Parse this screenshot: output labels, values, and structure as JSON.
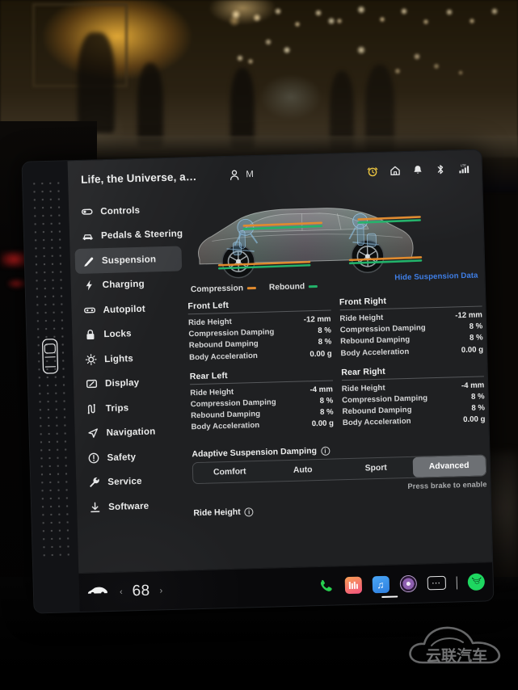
{
  "topbar": {
    "profile_title": "Life, the Universe, a…",
    "account_letter": "M",
    "icons": [
      {
        "name": "person-icon",
        "glyph": "person"
      },
      {
        "name": "alarm-clock-icon",
        "glyph": "alarm"
      },
      {
        "name": "home-icon",
        "glyph": "home"
      },
      {
        "name": "bell-icon",
        "glyph": "bell"
      },
      {
        "name": "bluetooth-icon",
        "glyph": "bluetooth"
      },
      {
        "name": "lte-signal-icon",
        "glyph": "lte"
      }
    ],
    "lte_label": "LTE"
  },
  "sidebar": {
    "items": [
      {
        "label": "Controls",
        "icon": "toggle-switch-icon",
        "active": false
      },
      {
        "label": "Pedals & Steering",
        "icon": "car-front-icon",
        "active": false
      },
      {
        "label": "Suspension",
        "icon": "shock-absorber-icon",
        "active": true
      },
      {
        "label": "Charging",
        "icon": "lightning-bolt-icon",
        "active": false
      },
      {
        "label": "Autopilot",
        "icon": "steering-assist-icon",
        "active": false
      },
      {
        "label": "Locks",
        "icon": "lock-icon",
        "active": false
      },
      {
        "label": "Lights",
        "icon": "sun-lights-icon",
        "active": false
      },
      {
        "label": "Display",
        "icon": "display-icon",
        "active": false
      },
      {
        "label": "Trips",
        "icon": "trips-icon",
        "active": false
      },
      {
        "label": "Navigation",
        "icon": "navigation-arrow-icon",
        "active": false
      },
      {
        "label": "Safety",
        "icon": "safety-info-icon",
        "active": false
      },
      {
        "label": "Service",
        "icon": "wrench-icon",
        "active": false
      },
      {
        "label": "Software",
        "icon": "download-icon",
        "active": false
      }
    ]
  },
  "suspension": {
    "legend": {
      "compression_label": "Compression",
      "compression_color": "#e08a2e",
      "rebound_label": "Rebound",
      "rebound_color": "#23b26a"
    },
    "hide_data_link": "Hide Suspension Data",
    "hide_data_link_color": "#3f7fe8",
    "corners": [
      {
        "title": "Front Left",
        "rows": [
          {
            "key": "Ride Height",
            "value": "-12 mm"
          },
          {
            "key": "Compression Damping",
            "value": "8 %"
          },
          {
            "key": "Rebound Damping",
            "value": "8 %"
          },
          {
            "key": "Body Acceleration",
            "value": "0.00 g"
          }
        ]
      },
      {
        "title": "Front Right",
        "rows": [
          {
            "key": "Ride Height",
            "value": "-12 mm"
          },
          {
            "key": "Compression Damping",
            "value": "8 %"
          },
          {
            "key": "Rebound Damping",
            "value": "8 %"
          },
          {
            "key": "Body Acceleration",
            "value": "0.00 g"
          }
        ]
      },
      {
        "title": "Rear Left",
        "rows": [
          {
            "key": "Ride Height",
            "value": "-4 mm"
          },
          {
            "key": "Compression Damping",
            "value": "8 %"
          },
          {
            "key": "Rebound Damping",
            "value": "8 %"
          },
          {
            "key": "Body Acceleration",
            "value": "0.00 g"
          }
        ]
      },
      {
        "title": "Rear Right",
        "rows": [
          {
            "key": "Ride Height",
            "value": "-4 mm"
          },
          {
            "key": "Compression Damping",
            "value": "8 %"
          },
          {
            "key": "Rebound Damping",
            "value": "8 %"
          },
          {
            "key": "Body Acceleration",
            "value": "0.00 g"
          }
        ]
      }
    ],
    "adaptive_damping": {
      "label": "Adaptive Suspension Damping",
      "options": [
        "Comfort",
        "Auto",
        "Sport",
        "Advanced"
      ],
      "selected": "Advanced",
      "note": "Press brake to enable"
    },
    "ride_height": {
      "label": "Ride Height"
    }
  },
  "dock": {
    "car_icon": "car-side-icon",
    "temp_prev": "‹",
    "temperature": "68",
    "temp_next": "›",
    "apps": [
      {
        "name": "phone-app-icon",
        "label": "Phone"
      },
      {
        "name": "music-app-icon",
        "label": "Music"
      },
      {
        "name": "media-note-app-icon",
        "label": "Audio"
      },
      {
        "name": "media-player-icon",
        "label": "Media"
      },
      {
        "name": "more-apps-icon",
        "label": "More"
      },
      {
        "name": "spotify-app-icon",
        "label": "Spotify"
      }
    ]
  },
  "watermark": {
    "text": "云联汽车"
  }
}
